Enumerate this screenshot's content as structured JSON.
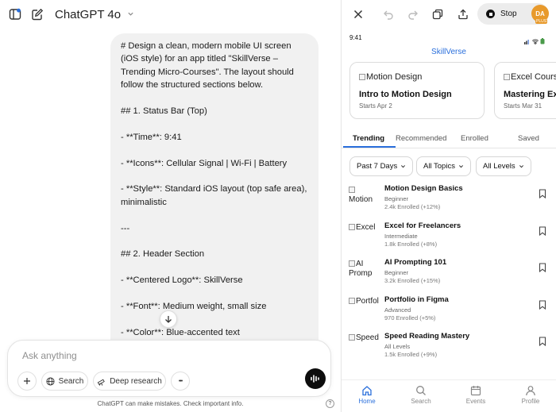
{
  "chat": {
    "title": "ChatGPT 4o",
    "message_lines": [
      "# Design a clean, modern mobile UI screen",
      "(iOS style) for an app titled \"SkillVerse –",
      "Trending Micro-Courses\". The layout should",
      "follow the structured sections below.",
      "",
      "## 1. Status Bar (Top)",
      "",
      "- **Time**: 9:41",
      "",
      "- **Icons**: Cellular Signal | Wi-Fi | Battery",
      "",
      "- **Style**: Standard iOS layout (top safe area),",
      "minimalistic",
      "",
      "---",
      "",
      "## 2. Header Section",
      "",
      "- **Centered Logo**: SkillVerse",
      "",
      "- **Font**: Medium weight, small size",
      "",
      "- **Color**: Blue-accented text"
    ],
    "composer_placeholder": "Ask anything",
    "search_label": "Search",
    "deep_research_label": "Deep research",
    "more_label": "•••",
    "disclaimer": "ChatGPT can make mistakes. Check important info.",
    "help_label": "?"
  },
  "preview": {
    "stop_label": "Stop",
    "avatar_initials": "DA",
    "avatar_badge": "PLUS",
    "status_time": "9:41",
    "logo": "SkillVerse",
    "featured": [
      {
        "img_alt": "Motion Design",
        "title": "Intro to Motion Design",
        "meta": "Starts Apr 2"
      },
      {
        "img_alt": "Excel Cours",
        "title": "Mastering Ex",
        "meta": "Starts Mar 31"
      }
    ],
    "tabs": [
      "Trending",
      "Recommended",
      "Enrolled",
      "Saved"
    ],
    "filters": [
      "Past 7 Days",
      "All Topics",
      "All Levels"
    ],
    "courses": [
      {
        "thumb": "Motion",
        "name": "Motion Design Basics",
        "level": "Beginner",
        "enrolled": "2.4k Enrolled (+12%)"
      },
      {
        "thumb": "Excel",
        "name": "Excel for Freelancers",
        "level": "Intermediate",
        "enrolled": "1.8k Enrolled (+8%)"
      },
      {
        "thumb": "AI Promp",
        "name": "AI Prompting 101",
        "level": "Beginner",
        "enrolled": "3.2k Enrolled (+15%)"
      },
      {
        "thumb": "Portfol",
        "name": "Portfolio in Figma",
        "level": "Advanced",
        "enrolled": "970 Enrolled (+5%)"
      },
      {
        "thumb": "Speed",
        "name": "Speed Reading Mastery",
        "level": "All Levels",
        "enrolled": "1.5k Enrolled (+9%)"
      }
    ],
    "nav": [
      "Home",
      "Search",
      "Events",
      "Profile"
    ]
  },
  "colors": {
    "accent": "#2a6fdc",
    "avatar": "#e89a2c",
    "bubble": "#f1f1f1"
  }
}
